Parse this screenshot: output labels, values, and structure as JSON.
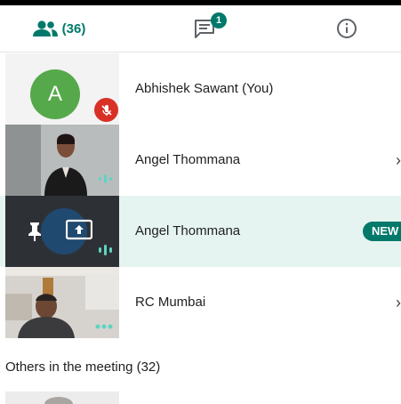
{
  "tabs": {
    "people": {
      "icon": "people-icon",
      "count": "(36)"
    },
    "chat": {
      "icon": "chat-icon",
      "badge": "1"
    },
    "info": {
      "icon": "info-icon"
    }
  },
  "participants": [
    {
      "name": "Abhishek Sawant (You)",
      "avatar_letter": "A",
      "muted": true,
      "avatar_color": "#56a94a"
    },
    {
      "name": "Angel Thommana",
      "chevron": "›"
    },
    {
      "name": "Angel Thommana",
      "badge": "NEW",
      "highlighted": true
    },
    {
      "name": "RC Mumbai",
      "chevron": "›"
    }
  ],
  "others_section": {
    "label": "Others in the meeting (32)"
  },
  "colors": {
    "accent": "#00796b",
    "muted_red": "#d93025",
    "highlight": "#e6f4f1"
  }
}
